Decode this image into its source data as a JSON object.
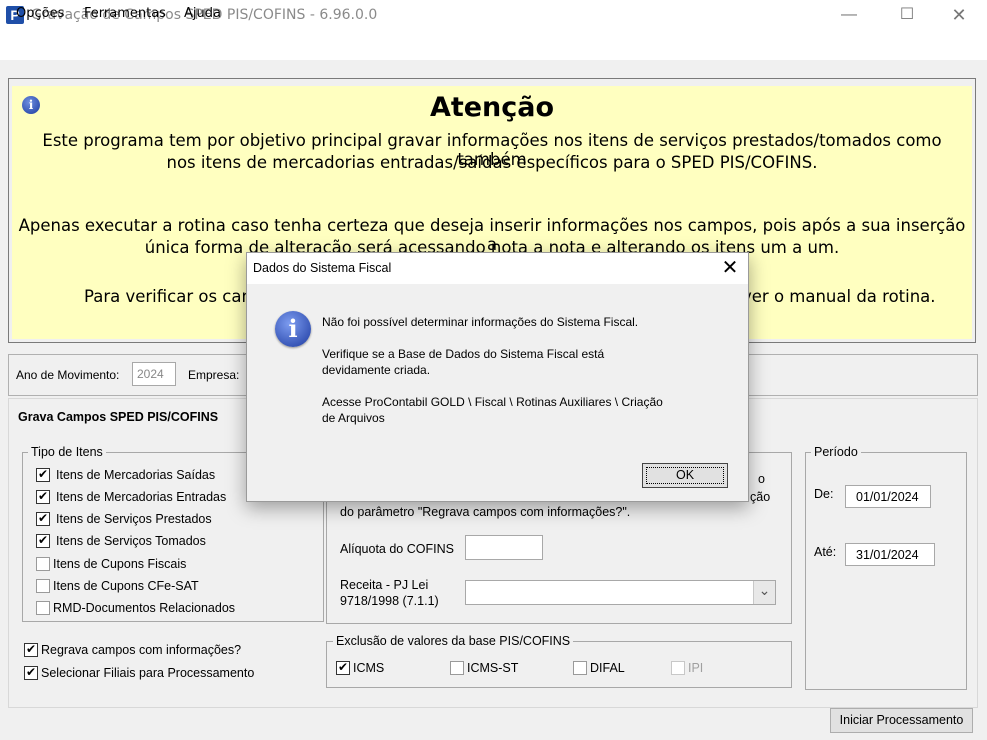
{
  "window": {
    "title": "Gravação de Campos SPED PIS/COFINS - 6.96.0.0",
    "app_icon_letter": "P",
    "min_glyph": "—",
    "max_glyph": "☐",
    "close_glyph": "✕"
  },
  "menu": {
    "items": [
      "Opções",
      "Ferramentas",
      "Ajuda"
    ]
  },
  "attention": {
    "title": "Atenção",
    "info_glyph": "i",
    "lines": [
      "Este programa tem por objetivo principal gravar informações nos itens de serviços prestados/tomados como também",
      "nos itens de mercadorias entradas/saídas específicos para o SPED PIS/COFINS.",
      "Apenas executar a rotina caso tenha certeza que deseja inserir informações nos campos, pois após a sua inserção a",
      "única forma de alteração será acessando nota a nota e alterando os itens um a um.",
      "Para verificar os campos",
      "ver o manual da rotina."
    ]
  },
  "ano": {
    "label": "Ano de Movimento:",
    "value": "2024",
    "empresa_label": "Empresa:"
  },
  "grava": {
    "title": "Grava Campos SPED PIS/COFINS"
  },
  "tipo_itens": {
    "legend": "Tipo de Itens",
    "items": [
      {
        "label": "Itens de Mercadorias Saídas",
        "checked": true
      },
      {
        "label": "Itens de Mercadorias Entradas",
        "checked": true
      },
      {
        "label": "Itens de Serviços Prestados",
        "checked": true
      },
      {
        "label": "Itens de Serviços Tomados",
        "checked": true
      },
      {
        "label": "Itens de Cupons Fiscais",
        "checked": false
      },
      {
        "label": "Itens de Cupons CFe-SAT",
        "checked": false
      },
      {
        "label": "RMD-Documentos Relacionados",
        "checked": false
      }
    ]
  },
  "options": {
    "regrava": {
      "label": "Regrava campos com informações?",
      "checked": true
    },
    "filiais": {
      "label": "Selecionar Filiais para Processamento",
      "checked": true
    }
  },
  "middle": {
    "partial_right_1": "o",
    "partial_right_2": "ção",
    "param_text": "do parâmetro \"Regrava campos com informações?\".",
    "aliquota_label": "Alíquota do COFINS",
    "aliquota_value": "",
    "receita_label_1": "Receita - PJ Lei",
    "receita_label_2": "9718/1998 (7.1.1)",
    "receita_value": "",
    "dropdown_glyph": "⌄"
  },
  "exclusao": {
    "legend": "Exclusão de valores da base PIS/COFINS",
    "items": [
      {
        "label": "ICMS",
        "checked": true
      },
      {
        "label": "ICMS-ST",
        "checked": false
      },
      {
        "label": "DIFAL",
        "checked": false
      },
      {
        "label": "IPI",
        "checked": false,
        "disabled": true
      }
    ]
  },
  "periodo": {
    "legend": "Período",
    "de_label": "De:",
    "de_value": "01/01/2024",
    "ate_label": "Até:",
    "ate_value": "31/01/2024"
  },
  "iniciar_button": "Iniciar Processamento",
  "dialog": {
    "title": "Dados do Sistema Fiscal",
    "close_glyph": "✕",
    "info_glyph": "i",
    "line1": "Não foi possível determinar informações do Sistema Fiscal.",
    "line2a": "Verifique se a Base de Dados do Sistema Fiscal está",
    "line2b": "devidamente criada.",
    "line3a": "Acesse ProContabil GOLD \\ Fiscal \\ Rotinas Auxiliares \\ Criação",
    "line3b": "de Arquivos",
    "ok_label": "OK"
  }
}
